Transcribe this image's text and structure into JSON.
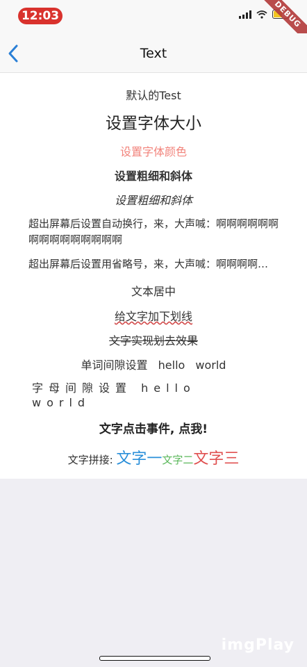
{
  "status_bar": {
    "time": "12:03",
    "debug_label": "DEBUG"
  },
  "nav": {
    "title": "Text"
  },
  "content": {
    "default_text": "默认的Test",
    "font_size_text": "设置字体大小",
    "font_color_text": "设置字体颜色",
    "bold_text": "设置粗细和斜体",
    "italic_text": "设置粗细和斜体",
    "wrap_text": "超出屏幕后设置自动换行，来，大声喊：啊啊啊啊啊啊啊啊啊啊啊啊啊啊啊",
    "ellipsis_text": "超出屏幕后设置用省略号，来，大声喊：啊啊啊啊啊啊啊啊啊啊啊",
    "center_text": "文本居中",
    "underline_text": "给文字加下划线",
    "strike_text": "文字实现划去效果",
    "word_spacing_text": "单词间隙设置 hello world",
    "letter_spacing_text": "字母间隙设置 hello world",
    "clickable_text": "文字点击事件, 点我!",
    "concat": {
      "prefix": "文字拼接: ",
      "part1": "文字一",
      "part2": "文字二",
      "part3": "文字三"
    }
  },
  "colors": {
    "accent": "#2a7fd6",
    "red_text": "#f2837b",
    "blue_span": "#2a8fd9",
    "green_span": "#5cb85c",
    "red_span": "#e05050"
  },
  "watermark": "imgPlay"
}
